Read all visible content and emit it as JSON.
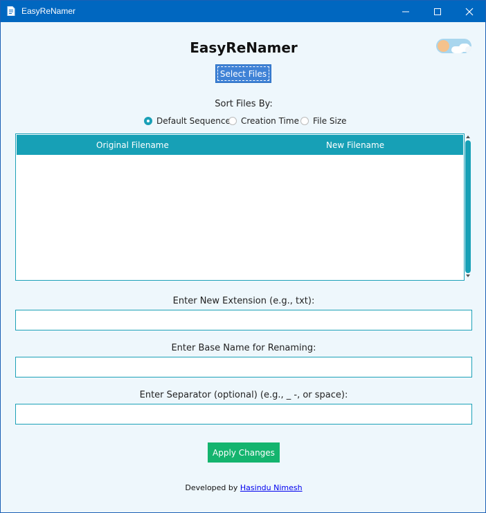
{
  "window": {
    "title": "EasyReNamer",
    "icon": "app-file-icon",
    "controls": [
      "minimize-icon",
      "maximize-icon",
      "close-icon"
    ]
  },
  "theme_toggle": {
    "state": "light",
    "icon": "sun-cloud-icon"
  },
  "app_title": "EasyReNamer",
  "select_files_label": "Select Files",
  "sort": {
    "label": "Sort Files By:",
    "options": [
      {
        "label": "Default Sequence",
        "selected": true
      },
      {
        "label": "Creation Time",
        "selected": false
      },
      {
        "label": "File Size",
        "selected": false
      }
    ]
  },
  "table": {
    "columns": [
      "Original Filename",
      "New Filename"
    ],
    "rows": []
  },
  "fields": {
    "extension": {
      "label": "Enter New Extension (e.g., txt):",
      "value": ""
    },
    "base_name": {
      "label": "Enter Base Name for Renaming:",
      "value": ""
    },
    "separator": {
      "label": "Enter Separator (optional) (e.g., _ -, or space):",
      "value": ""
    }
  },
  "apply_label": "Apply Changes",
  "footer": {
    "prefix": "Developed by ",
    "author": "Hasindu Nimesh"
  },
  "colors": {
    "titlebar": "#0067c0",
    "accent_teal": "#17a0b6",
    "select_button": "#3f82d6",
    "apply_button": "#14b46e",
    "background": "#eef7fc"
  }
}
